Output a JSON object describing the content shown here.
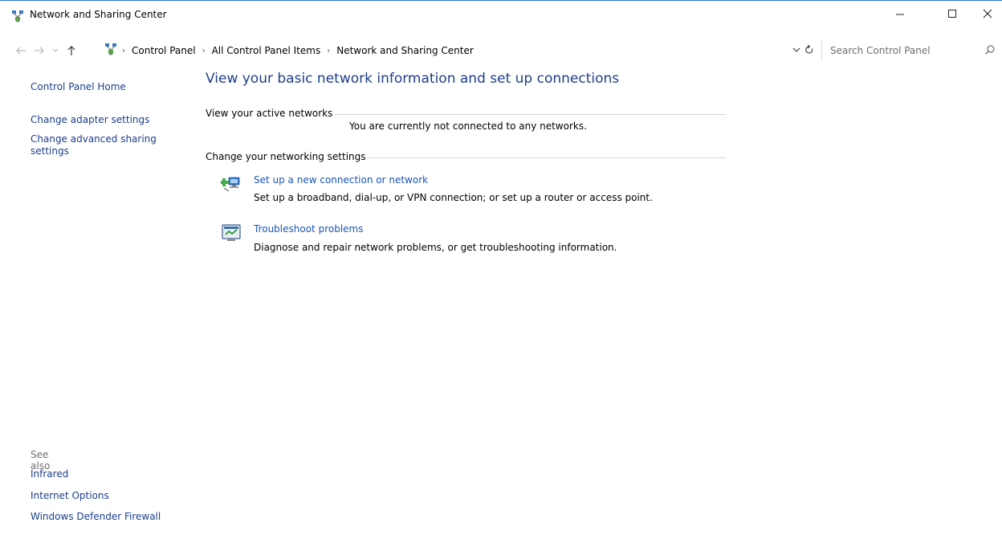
{
  "window": {
    "title": "Network and Sharing Center"
  },
  "titlebar_buttons": {
    "minimize": "—",
    "maximize": "☐",
    "close": "✕"
  },
  "address_bar": {
    "breadcrumbs": [
      "Control Panel",
      "All Control Panel Items",
      "Network and Sharing Center"
    ],
    "separator": "›"
  },
  "search": {
    "placeholder": "Search Control Panel"
  },
  "left_nav": {
    "home": "Control Panel Home",
    "links": [
      "Change adapter settings",
      "Change advanced sharing settings"
    ]
  },
  "see_also": {
    "title": "See also",
    "links": [
      "Infrared",
      "Internet Options",
      "Windows Defender Firewall"
    ]
  },
  "main": {
    "title": "View your basic network information and set up connections",
    "active_networks": {
      "header": "View your active networks",
      "status": "You are currently not connected to any networks."
    },
    "networking_settings": {
      "header": "Change your networking settings",
      "tasks": [
        {
          "icon": "network-setup-icon",
          "title": "Set up a new connection or network",
          "description": "Set up a broadband, dial-up, or VPN connection; or set up a router or access point."
        },
        {
          "icon": "troubleshoot-icon",
          "title": "Troubleshoot problems",
          "description": "Diagnose and repair network problems, or get troubleshooting information."
        }
      ]
    }
  },
  "colors": {
    "link": "#1a3e8c",
    "title": "#1e3e8b",
    "task_link": "#1a55b5",
    "muted": "#707070"
  }
}
